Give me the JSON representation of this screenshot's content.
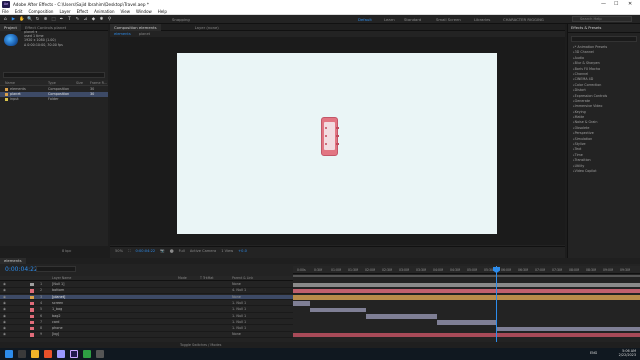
{
  "window": {
    "logo": "Ae",
    "title": "Adobe After Effects - C:\\Users\\Sajid Ibrahim\\Desktop\\Travel.aep *",
    "minimize": "—",
    "maximize": "☐",
    "close": "✕"
  },
  "menu": [
    "File",
    "Edit",
    "Composition",
    "Layer",
    "Effect",
    "Animation",
    "View",
    "Window",
    "Help"
  ],
  "toolbar": {
    "tools": [
      "⌂",
      "▶",
      "✋",
      "🔍",
      "↻",
      "⊕",
      "⬚",
      "✒",
      "T",
      "✎",
      "⊿",
      "◆",
      "✱",
      "⚲"
    ],
    "snapping_label": "Snapping",
    "workspaces": [
      "Default",
      "Learn",
      "Standard",
      "Small Screen",
      "Libraries",
      "CHARACTER RIGGING"
    ],
    "active_workspace": "Default",
    "search_placeholder": "Search Help"
  },
  "project": {
    "tabs": [
      "Project",
      "Effect Controls planet"
    ],
    "info": {
      "name": "planet ▾",
      "line1": "used 1 time",
      "line2": "1920 x 1080 (1.00)",
      "line3": "Δ 0:00:10:00, 30.00 fps"
    },
    "columns": [
      "Name",
      "Type",
      "Size",
      "Frame R..."
    ],
    "items": [
      {
        "name": "elements",
        "type": "Composition",
        "size": "30",
        "color": "#d9a04b",
        "selected": false
      },
      {
        "name": "planet",
        "type": "Composition",
        "size": "30",
        "color": "#d9a04b",
        "selected": true
      },
      {
        "name": "input",
        "type": "Folder",
        "size": "",
        "color": "#d9c34b",
        "selected": false
      }
    ],
    "footer_bpc": "8 bpc"
  },
  "composition": {
    "tab_label": "Composition elements",
    "layer_tab": "Layer (none)",
    "subtabs": [
      "elements",
      "planet"
    ],
    "viewer_bar": [
      "50%",
      "⛶",
      "0:00:04:22",
      "📷",
      "⬤",
      "Full",
      "Active Camera",
      "1 View",
      "+0.0"
    ]
  },
  "effects": {
    "title": "Effects & Presets",
    "search_placeholder": "",
    "items": [
      "* Animation Presets",
      "3D Channel",
      "Audio",
      "Blur & Sharpen",
      "Boris FX Mocha",
      "Channel",
      "CINEMA 4D",
      "Color Correction",
      "Distort",
      "Expression Controls",
      "Generate",
      "Immersive Video",
      "Keying",
      "Matte",
      "Noise & Grain",
      "Obsolete",
      "Perspective",
      "Simulation",
      "Stylize",
      "Text",
      "Time",
      "Transition",
      "Utility",
      "Video Copilot"
    ]
  },
  "timeline": {
    "tab_label": "elements",
    "current_time": "0:00:04:22",
    "columns": [
      "Layer Name",
      "Mode",
      "T TrkMat",
      "Parent & Link"
    ],
    "ruler": [
      "0:00s",
      "0:30f",
      "01:00f",
      "01:30f",
      "02:00f",
      "02:30f",
      "03:00f",
      "03:30f",
      "04:00f",
      "04:30f",
      "05:00f",
      "05:30f",
      "06:00f",
      "06:30f",
      "07:00f",
      "07:30f",
      "08:00f",
      "08:30f",
      "09:00f",
      "09:30f"
    ],
    "layers": [
      {
        "num": "1",
        "name": "[Null 1]",
        "parent": "None",
        "color": "#a0a0a0",
        "selected": false
      },
      {
        "num": "2",
        "name": "bottom",
        "parent": "4. Null 1",
        "color": "#e06c7a",
        "selected": false
      },
      {
        "num": "3",
        "name": "[planet]",
        "parent": "None",
        "color": "#d9a04b",
        "selected": true
      },
      {
        "num": "4",
        "name": "screen",
        "parent": "1. Null 1",
        "color": "#e06c7a",
        "selected": false
      },
      {
        "num": "5",
        "name": "1_bag",
        "parent": "1. Null 1",
        "color": "#e06c7a",
        "selected": false
      },
      {
        "num": "6",
        "name": "bag2",
        "parent": "1. Null 1",
        "color": "#e06c7a",
        "selected": false
      },
      {
        "num": "7",
        "name": "card",
        "parent": "1. Null 1",
        "color": "#e06c7a",
        "selected": false
      },
      {
        "num": "8",
        "name": "phone",
        "parent": "1. Null 1",
        "color": "#e06c7a",
        "selected": false
      },
      {
        "num": "9",
        "name": "[bg]",
        "parent": "None",
        "color": "#e06c7a",
        "selected": false
      }
    ],
    "footer": "Toggle Switches / Modes"
  },
  "taskbar": {
    "time": "5:06 AM",
    "date": "2/22/2023",
    "lang": "ENG"
  },
  "colors": {
    "accent": "#2d8ceb",
    "canvas": "#eaf5f6",
    "phone": "#e27582"
  }
}
